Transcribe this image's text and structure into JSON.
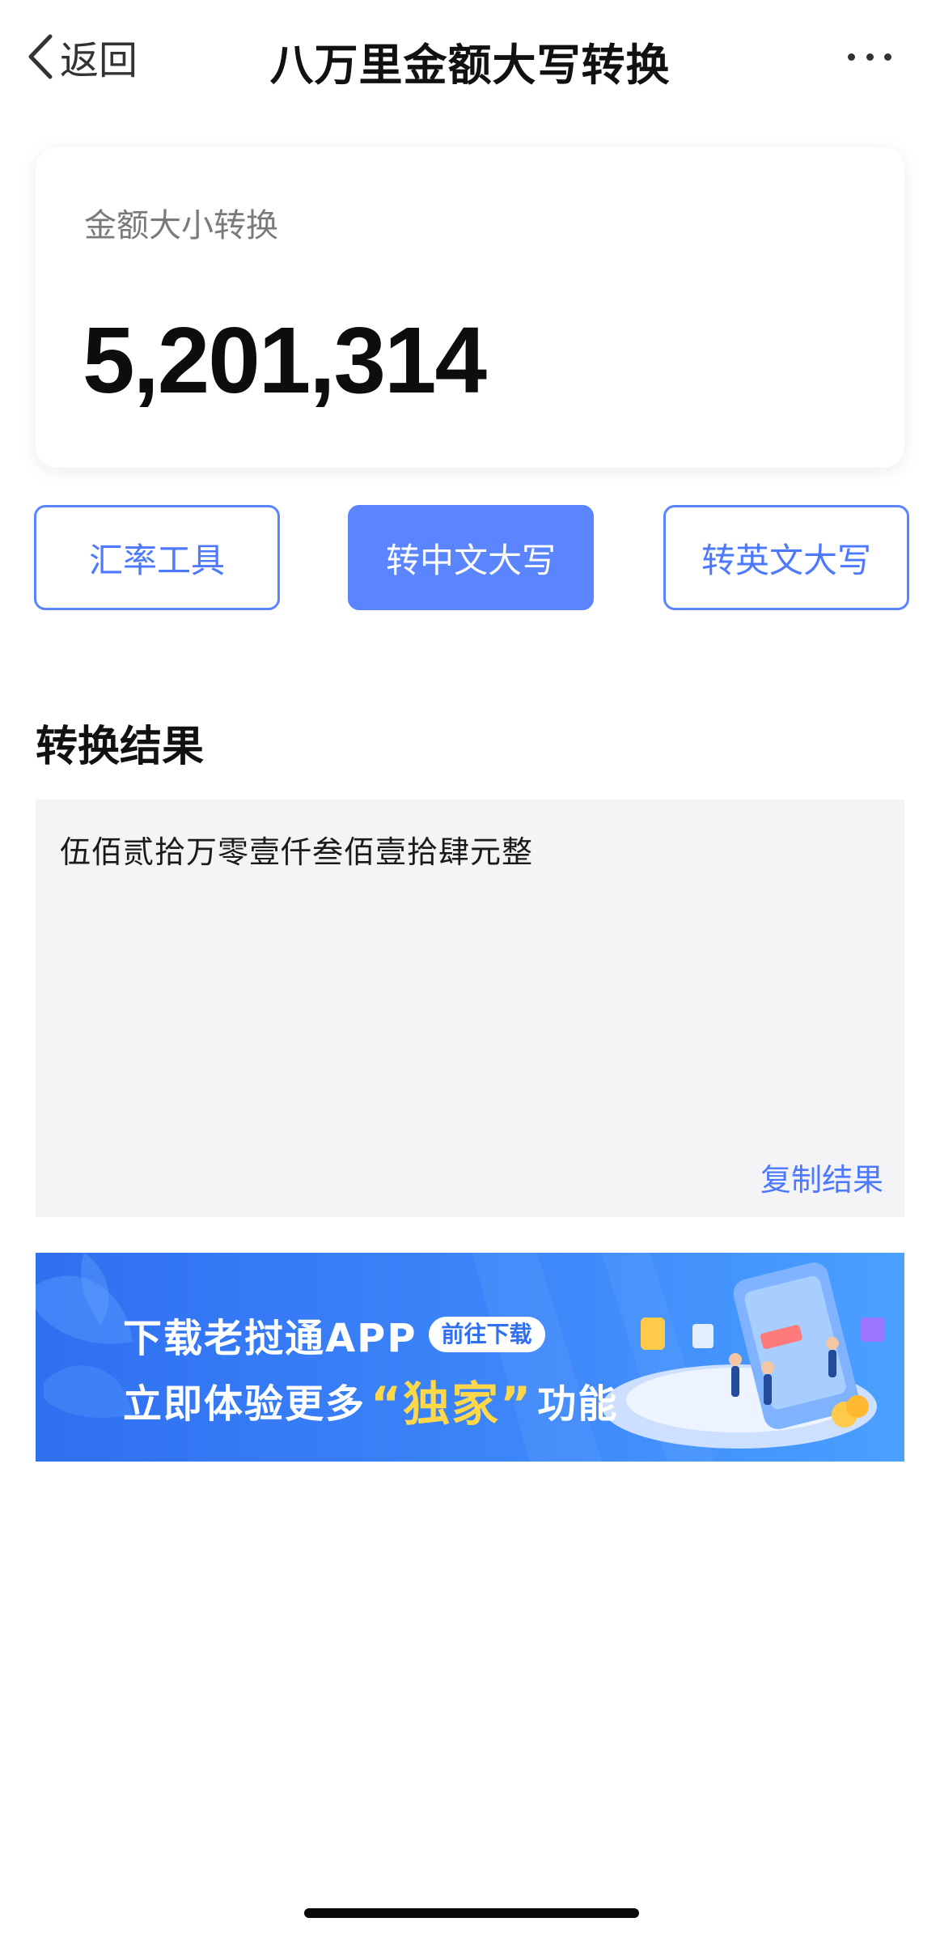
{
  "nav": {
    "back_label": "返回",
    "title": "八万里金额大写转换",
    "more_icon": "more-icon"
  },
  "amount_card": {
    "label": "金额大小转换",
    "value": "5,201,314"
  },
  "buttons": {
    "rate_tool": "汇率工具",
    "to_chinese": "转中文大写",
    "to_english": "转英文大写",
    "active": "to_chinese"
  },
  "result": {
    "title": "转换结果",
    "text": "伍佰贰拾万零壹仟叁佰壹拾肆元整",
    "copy_label": "复制结果"
  },
  "banner": {
    "line1": "下载老挝通APP",
    "pill": "前往下载",
    "line2_prefix": "立即体验更多",
    "line2_highlight": "“独家”",
    "line2_suffix": "功能"
  },
  "colors": {
    "accent": "#5b85ff",
    "banner": "#2f6ff0",
    "highlight": "#ffd84a"
  }
}
